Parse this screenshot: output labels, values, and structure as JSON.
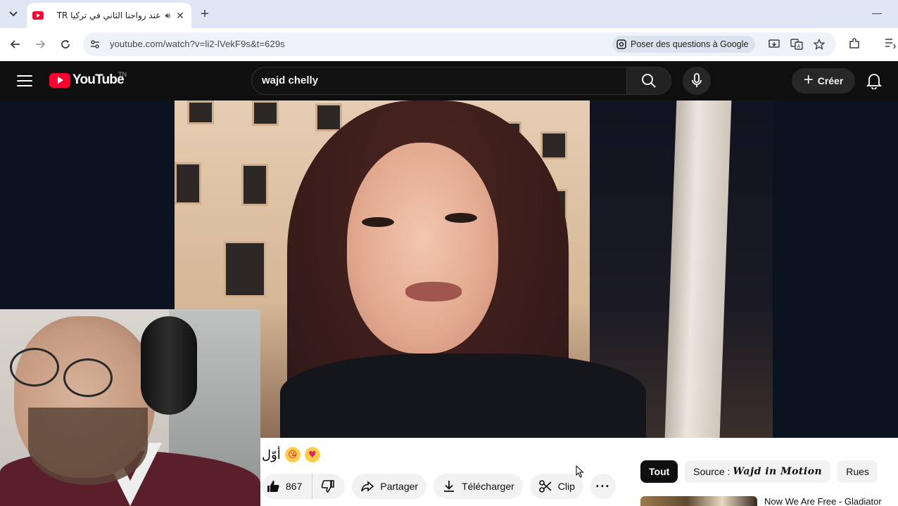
{
  "browser": {
    "tab": {
      "title": "عند رواحنا الثاني في تركيا TR",
      "close_label": "✕"
    },
    "new_tab_label": "+",
    "minimize_label": "—",
    "address_bar": {
      "url": "youtube.com/watch?v=li2-lVekF9s&t=629s",
      "ask_google_label": "Poser des questions à Google"
    }
  },
  "youtube": {
    "logo_text": "YouTube",
    "country_code": "TN",
    "search": {
      "value": "wajd chelly"
    },
    "create_label": "Créer",
    "video": {
      "title_fragment": "أوّل"
    },
    "actions": {
      "like_count": "867",
      "share_label": "Partager",
      "download_label": "Télécharger",
      "clip_label": "Clip",
      "more_label": "···"
    },
    "chips": [
      {
        "label": "Tout",
        "active": true
      },
      {
        "label": "Source :",
        "source_name": "Wajd in Motion",
        "active": false
      },
      {
        "label": "Rues",
        "active": false
      }
    ],
    "recommendation": {
      "title": "Now We Are Free - Gladiator"
    }
  },
  "colors": {
    "brand_red": "#ff0033",
    "masthead_bg": "#0f0f0f",
    "chip_active_bg": "#0f0f0f"
  },
  "icons": [
    "tab-list-icon",
    "youtube-favicon-icon",
    "audio-icon",
    "close-icon",
    "plus-icon",
    "back-icon",
    "forward-icon",
    "reload-icon",
    "site-info-icon",
    "google-lens-icon",
    "install-icon",
    "translate-icon",
    "star-icon",
    "extensions-icon",
    "reading-list-icon",
    "hamburger-icon",
    "search-icon",
    "mic-icon",
    "bell-icon",
    "like-icon",
    "dislike-icon",
    "share-icon",
    "download-icon",
    "scissors-icon",
    "more-icon"
  ]
}
